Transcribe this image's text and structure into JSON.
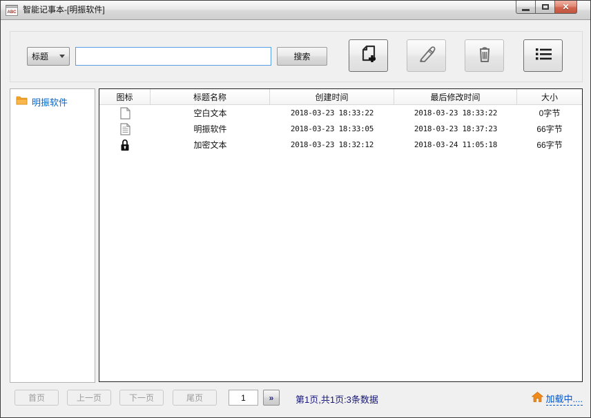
{
  "window": {
    "title": "智能记事本-[明振软件]",
    "app_icon_label": "ABC",
    "controls": [
      "minimize-icon",
      "maximize-icon",
      "close-icon"
    ]
  },
  "toolbar": {
    "filter_dropdown": {
      "value": "标题"
    },
    "search_input": {
      "value": "",
      "placeholder": ""
    },
    "search_button_label": "搜索",
    "icon_buttons": [
      {
        "name": "new-note-button",
        "icon": "new-document-icon"
      },
      {
        "name": "edit-note-button",
        "icon": "pencil-icon"
      },
      {
        "name": "delete-note-button",
        "icon": "trash-icon"
      },
      {
        "name": "list-view-button",
        "icon": "list-icon"
      }
    ]
  },
  "sidebar": {
    "items": [
      {
        "icon": "folder-icon",
        "label": "明振软件"
      }
    ]
  },
  "table": {
    "columns": [
      "图标",
      "标题名称",
      "创建时间",
      "最后修改时间",
      "大小"
    ],
    "rows": [
      {
        "icon": "blank-document",
        "title": "空白文本",
        "created": "2018-03-23 18:33:22",
        "modified": "2018-03-23 18:33:22",
        "size": "0字节"
      },
      {
        "icon": "text-document",
        "title": "明振软件",
        "created": "2018-03-23 18:33:05",
        "modified": "2018-03-23 18:37:23",
        "size": "66字节"
      },
      {
        "icon": "lock-document",
        "title": "加密文本",
        "created": "2018-03-23 18:32:12",
        "modified": "2018-03-24 11:05:18",
        "size": "66字节"
      }
    ]
  },
  "pagination": {
    "first_label": "首页",
    "prev_label": "上一页",
    "next_label": "下一页",
    "last_label": "尾页",
    "page_input_value": "1",
    "go_button_label": "»",
    "status": "第1页,共1页:3条数据",
    "load_link_label": "加载中...."
  },
  "colors": {
    "link": "#0055cc",
    "status_text": "#16167a",
    "folder_icon": "#f09a28",
    "sidebar_item_text": "#0066cc",
    "close_button": "#c05540"
  }
}
